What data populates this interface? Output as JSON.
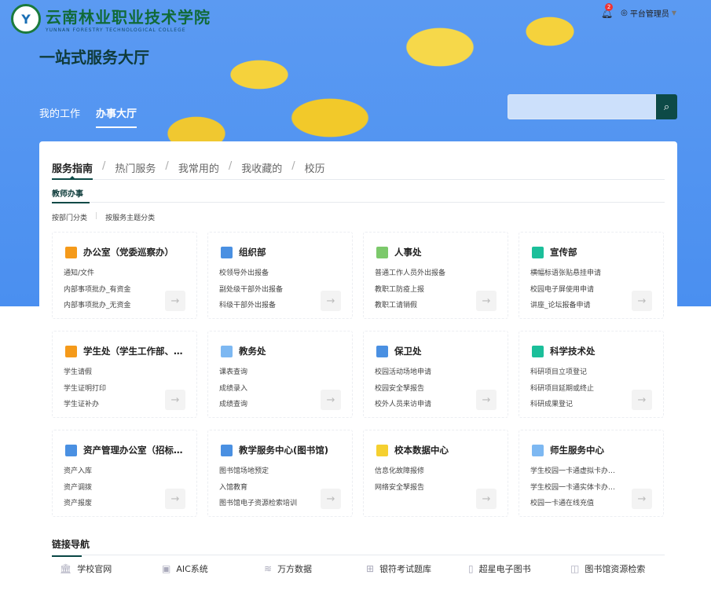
{
  "header": {
    "school_name_cn": "云南林业职业技术学院",
    "school_name_en": "YUNNAN FORESTRY TECHNOLOGICAL COLLEGE",
    "notification_count": "2",
    "user": "平台管理员",
    "page_title": "一站式服务大厅",
    "nav": [
      "我的工作",
      "办事大厅"
    ],
    "active_nav": "办事大厅",
    "search_placeholder": ""
  },
  "tabs": [
    "服务指南",
    "热门服务",
    "我常用的",
    "我收藏的",
    "校历"
  ],
  "subtab": "教师办事",
  "classify": [
    "按部门分类",
    "按服务主题分类"
  ],
  "colors": {
    "accent": "#0d4a47",
    "hero": "#4a8ff0"
  },
  "departments": [
    {
      "name": "办公室（党委巡察办）",
      "icon": "chart-board-icon",
      "color": "#f59a1a",
      "items": [
        "通知/文件",
        "内部事项批办_有资金",
        "内部事项批办_无资金"
      ]
    },
    {
      "name": "组织部",
      "icon": "clipboard-icon",
      "color": "#4a90e2",
      "items": [
        "校领导外出报备",
        "副处级干部外出报备",
        "科级干部外出报备"
      ]
    },
    {
      "name": "人事处",
      "icon": "hr-monitor-icon",
      "color": "#7cc96b",
      "items": [
        "普通工作人员外出报备",
        "教职工防疫上报",
        "教职工请销假"
      ]
    },
    {
      "name": "宣传部",
      "icon": "screen-icon",
      "color": "#1bbf9a",
      "items": [
        "横幅标语张贴悬挂申请",
        "校园电子屏使用申请",
        "讲座_论坛报备申请"
      ]
    },
    {
      "name": "学生处（学生工作部、…",
      "icon": "people-icon",
      "color": "#f59a1a",
      "items": [
        "学生请假",
        "学生证明打印",
        "学生证补办"
      ]
    },
    {
      "name": "教务处",
      "icon": "book-icon",
      "color": "#7db8f2",
      "items": [
        "课表查询",
        "成绩录入",
        "成绩查询"
      ]
    },
    {
      "name": "保卫处",
      "icon": "guard-icon",
      "color": "#4a90e2",
      "items": [
        "校园活动场地申请",
        "校园安全孥报告",
        "校外人员来访申请"
      ]
    },
    {
      "name": "科学技术处",
      "icon": "flask-icon",
      "color": "#1bbf9a",
      "items": [
        "科研项目立项登记",
        "科研项目延期或终止",
        "科研成果登记"
      ]
    },
    {
      "name": "资产管理办公室（招标…",
      "icon": "monitor-icon",
      "color": "#4a90e2",
      "items": [
        "资产入库",
        "资产调拨",
        "资产报废"
      ]
    },
    {
      "name": "教学服务中心(图书馆)",
      "icon": "server-icon",
      "color": "#4a90e2",
      "items": [
        "图书馆场地预定",
        "入馆教育",
        "图书馆电子资源检索培训"
      ]
    },
    {
      "name": "校本数据中心",
      "icon": "data-exchange-icon",
      "color": "#f5d030",
      "items": [
        "信息化故障报修",
        "网络安全孥报告"
      ]
    },
    {
      "name": "师生服务中心",
      "icon": "card-icon",
      "color": "#7db8f2",
      "items": [
        "学生校园一卡通虚拟卡办…",
        "学生校园一卡通实体卡办…",
        "校园一卡通在线充值"
      ]
    }
  ],
  "links_title": "链接导航",
  "links": [
    {
      "label": "学校官网",
      "icon": "bank-icon",
      "glyph": "🏛"
    },
    {
      "label": "AIC系统",
      "icon": "id-badge-icon",
      "glyph": "▣"
    },
    {
      "label": "万方数据",
      "icon": "layers-icon",
      "glyph": "≋"
    },
    {
      "label": "银符考试题库",
      "icon": "grid-icon",
      "glyph": "⊞"
    },
    {
      "label": "超星电子图书",
      "icon": "door-book-icon",
      "glyph": "▯"
    },
    {
      "label": "图书馆资源检索",
      "icon": "open-book-icon",
      "glyph": "◫"
    }
  ]
}
